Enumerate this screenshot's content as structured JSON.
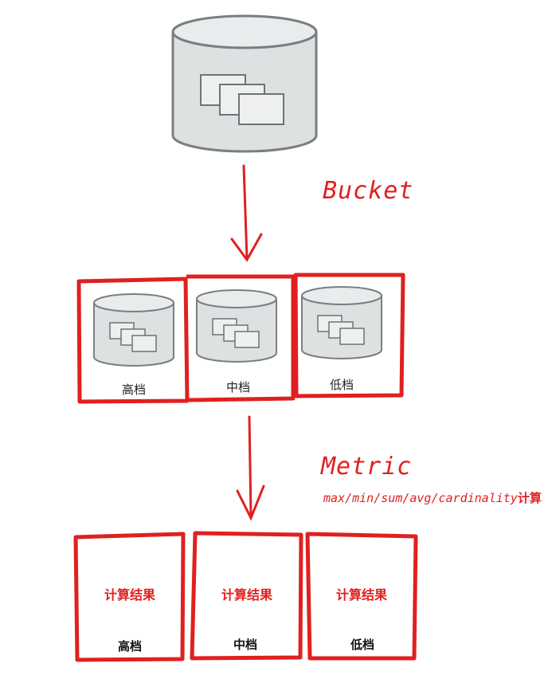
{
  "labels": {
    "bucket": "Bucket",
    "metric": "Metric",
    "metric_sub_ops": "max/min/sum/avg/cardinality",
    "metric_sub_suffix": "计算"
  },
  "tiers": [
    {
      "label": "高档",
      "result": "计算结果",
      "result_label": "高档"
    },
    {
      "label": "中档",
      "result": "计算结果",
      "result_label": "中档"
    },
    {
      "label": "低档",
      "result": "计算结果",
      "result_label": "低档"
    }
  ],
  "colors": {
    "accent": "#e02020",
    "cylinder_fill": "#dde1e2",
    "cylinder_stroke": "#7a7e80"
  }
}
